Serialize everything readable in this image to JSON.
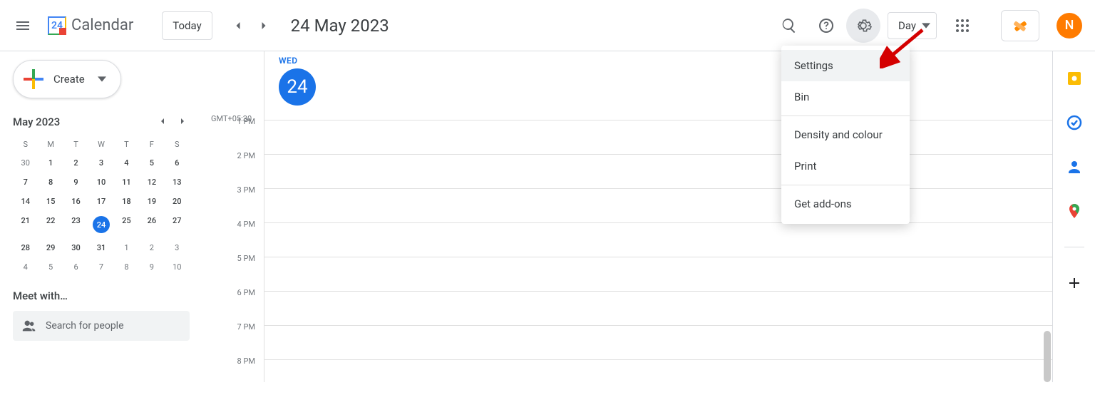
{
  "header": {
    "app_name": "Calendar",
    "logo_day": "24",
    "today_label": "Today",
    "date_title": "24 May 2023",
    "view_label": "Day",
    "avatar_initial": "N"
  },
  "sidebar": {
    "create_label": "Create",
    "mini_month_title": "May 2023",
    "dow": [
      "S",
      "M",
      "T",
      "W",
      "T",
      "F",
      "S"
    ],
    "weeks": [
      [
        {
          "n": "30",
          "muted": true
        },
        {
          "n": "1"
        },
        {
          "n": "2"
        },
        {
          "n": "3"
        },
        {
          "n": "4"
        },
        {
          "n": "5"
        },
        {
          "n": "6"
        }
      ],
      [
        {
          "n": "7"
        },
        {
          "n": "8"
        },
        {
          "n": "9"
        },
        {
          "n": "10"
        },
        {
          "n": "11"
        },
        {
          "n": "12"
        },
        {
          "n": "13"
        }
      ],
      [
        {
          "n": "14"
        },
        {
          "n": "15"
        },
        {
          "n": "16"
        },
        {
          "n": "17"
        },
        {
          "n": "18"
        },
        {
          "n": "19"
        },
        {
          "n": "20"
        }
      ],
      [
        {
          "n": "21"
        },
        {
          "n": "22"
        },
        {
          "n": "23"
        },
        {
          "n": "24",
          "today": true
        },
        {
          "n": "25"
        },
        {
          "n": "26"
        },
        {
          "n": "27"
        }
      ],
      [
        {
          "n": "28"
        },
        {
          "n": "29"
        },
        {
          "n": "30"
        },
        {
          "n": "31"
        },
        {
          "n": "1",
          "muted": true
        },
        {
          "n": "2",
          "muted": true
        },
        {
          "n": "3",
          "muted": true
        }
      ],
      [
        {
          "n": "4",
          "muted": true
        },
        {
          "n": "5",
          "muted": true
        },
        {
          "n": "6",
          "muted": true
        },
        {
          "n": "7",
          "muted": true
        },
        {
          "n": "8",
          "muted": true
        },
        {
          "n": "9",
          "muted": true
        },
        {
          "n": "10",
          "muted": true
        }
      ]
    ],
    "meet_with_title": "Meet with…",
    "search_placeholder": "Search for people"
  },
  "dayview": {
    "timezone": "GMT+05:30",
    "dow_label": "WED",
    "day_number": "24",
    "hours": [
      "1 PM",
      "2 PM",
      "3 PM",
      "4 PM",
      "5 PM",
      "6 PM",
      "7 PM",
      "8 PM"
    ]
  },
  "settings_menu": {
    "items": [
      "Settings",
      "Bin"
    ],
    "items2": [
      "Density and colour",
      "Print"
    ],
    "items3": [
      "Get add-ons"
    ]
  }
}
